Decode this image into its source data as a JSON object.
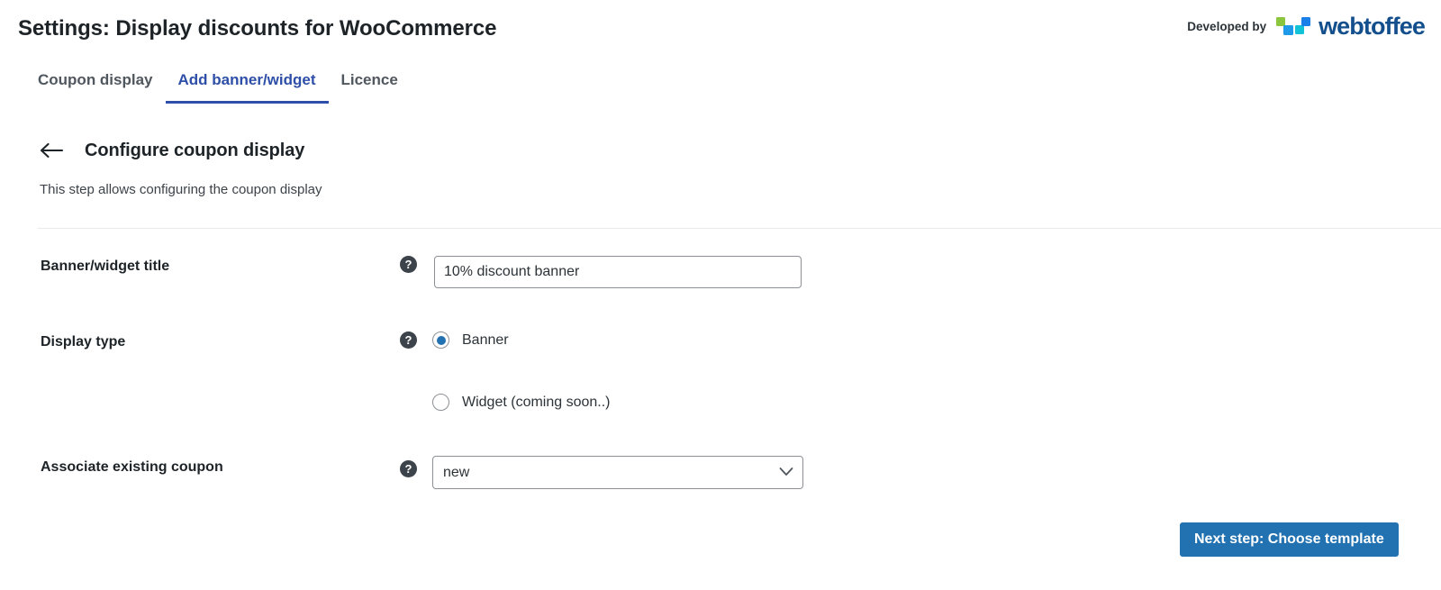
{
  "header": {
    "title": "Settings: Display discounts for WooCommerce",
    "developed_by_label": "Developed by",
    "brand_name": "webtoffee",
    "brand_colors": {
      "green": "#8cc63e",
      "blue": "#1e9ae8",
      "cyan": "#12c2d6",
      "royal_blue": "#1a7fe8",
      "wordmark": "#134f8c"
    }
  },
  "tabs": [
    {
      "label": "Coupon display",
      "active": false
    },
    {
      "label": "Add banner/widget",
      "active": true
    },
    {
      "label": "Licence",
      "active": false
    }
  ],
  "step": {
    "back_icon": "arrow-left-icon",
    "title": "Configure coupon display",
    "description": "This step allows configuring the coupon display"
  },
  "form": {
    "help_glyph": "?",
    "fields": {
      "banner_title": {
        "label": "Banner/widget title",
        "value": "10% discount banner",
        "placeholder": "Banner/widget title"
      },
      "display_type": {
        "label": "Display type",
        "options": [
          {
            "label": "Banner",
            "checked": true
          },
          {
            "label": "Widget (coming soon..)",
            "checked": false
          }
        ]
      },
      "associate_coupon": {
        "label": "Associate existing coupon",
        "value": "new",
        "options": [
          "new"
        ]
      }
    }
  },
  "footer": {
    "next_button_label": "Next step: Choose template",
    "accent_color": "#2271b1"
  }
}
